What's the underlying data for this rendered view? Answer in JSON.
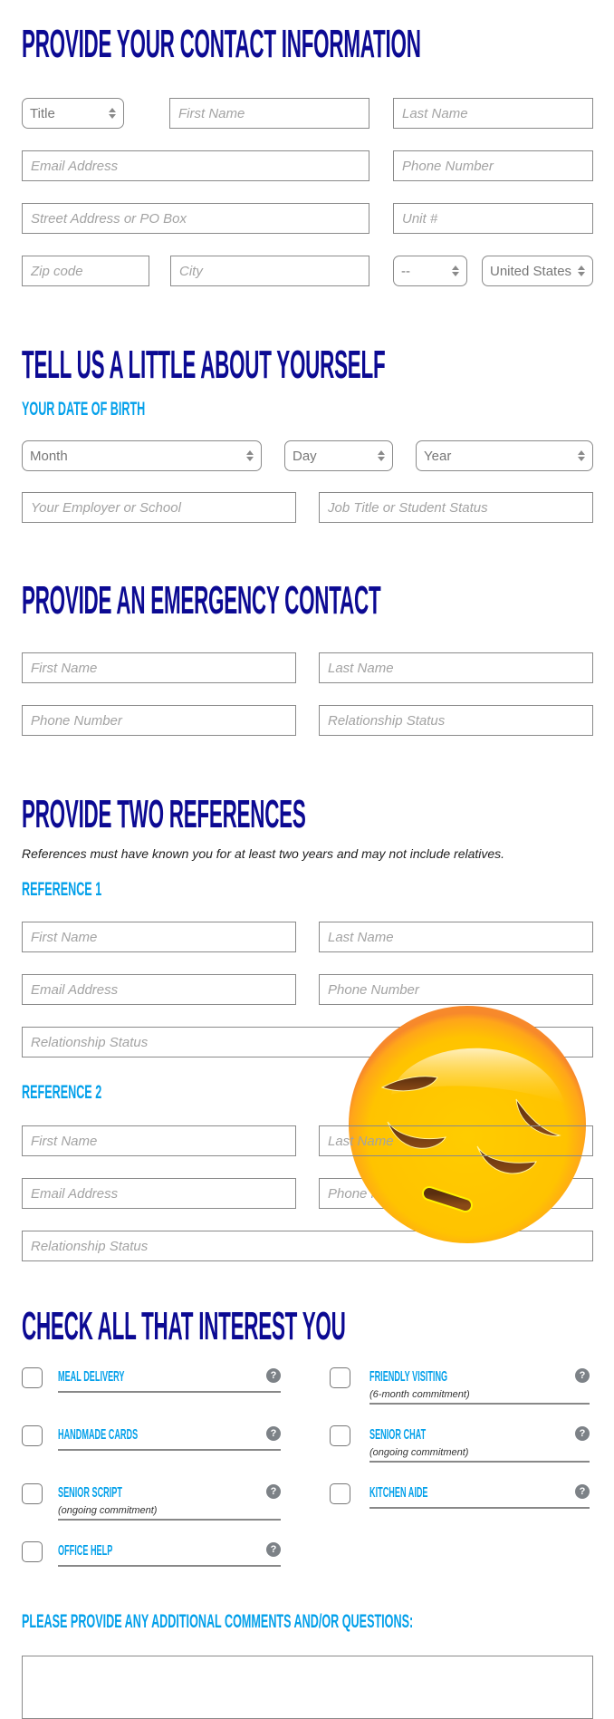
{
  "contact": {
    "heading": "PROVIDE YOUR CONTACT INFORMATION",
    "title_select": "Title",
    "first_name": "First Name",
    "last_name": "Last Name",
    "email": "Email Address",
    "phone": "Phone Number",
    "street": "Street Address or PO Box",
    "unit": "Unit #",
    "zip": "Zip code",
    "city": "City",
    "state_select": "--",
    "country_select": "United States"
  },
  "about": {
    "heading": "TELL US A LITTLE ABOUT YOURSELF",
    "dob_label": "YOUR DATE OF BIRTH",
    "month": "Month",
    "day": "Day",
    "year": "Year",
    "employer": "Your Employer or School",
    "job_title": "Job Title or Student Status"
  },
  "emergency": {
    "heading": "PROVIDE AN EMERGENCY CONTACT",
    "first_name": "First Name",
    "last_name": "Last Name",
    "phone": "Phone Number",
    "relationship": "Relationship Status"
  },
  "references": {
    "heading": "PROVIDE TWO REFERENCES",
    "note": "References must have known you for at least two years and may not include relatives.",
    "items": [
      {
        "label": "REFERENCE 1",
        "first_name": "First Name",
        "last_name": "Last Name",
        "email": "Email Address",
        "phone": "Phone Number",
        "relationship": "Relationship Status"
      },
      {
        "label": "REFERENCE 2",
        "first_name": "First Name",
        "last_name": "Last Name",
        "email": "Email Address",
        "phone": "Phone Number",
        "relationship": "Relationship Status"
      }
    ]
  },
  "interests": {
    "heading": "CHECK ALL THAT INTEREST YOU",
    "help_glyph": "?",
    "options": [
      {
        "label": "MEAL DELIVERY",
        "sub": ""
      },
      {
        "label": "FRIENDLY VISITING",
        "sub": "(6-month commitment)"
      },
      {
        "label": "HANDMADE CARDS",
        "sub": ""
      },
      {
        "label": "SENIOR CHAT",
        "sub": "(ongoing commitment)"
      },
      {
        "label": "SENIOR SCRIPT",
        "sub": "(ongoing commitment)"
      },
      {
        "label": "KITCHEN AIDE",
        "sub": ""
      },
      {
        "label": "OFFICE HELP",
        "sub": ""
      }
    ]
  },
  "comments": {
    "label": "PLEASE PROVIDE ANY ADDITIONAL COMMENTS AND/OR QUESTIONS:"
  },
  "overlay": {
    "icon": "pensive-face-emoji"
  },
  "colors": {
    "heading": "#0c0a93",
    "subheading": "#03a0ea",
    "emoji": "#ffc200"
  }
}
